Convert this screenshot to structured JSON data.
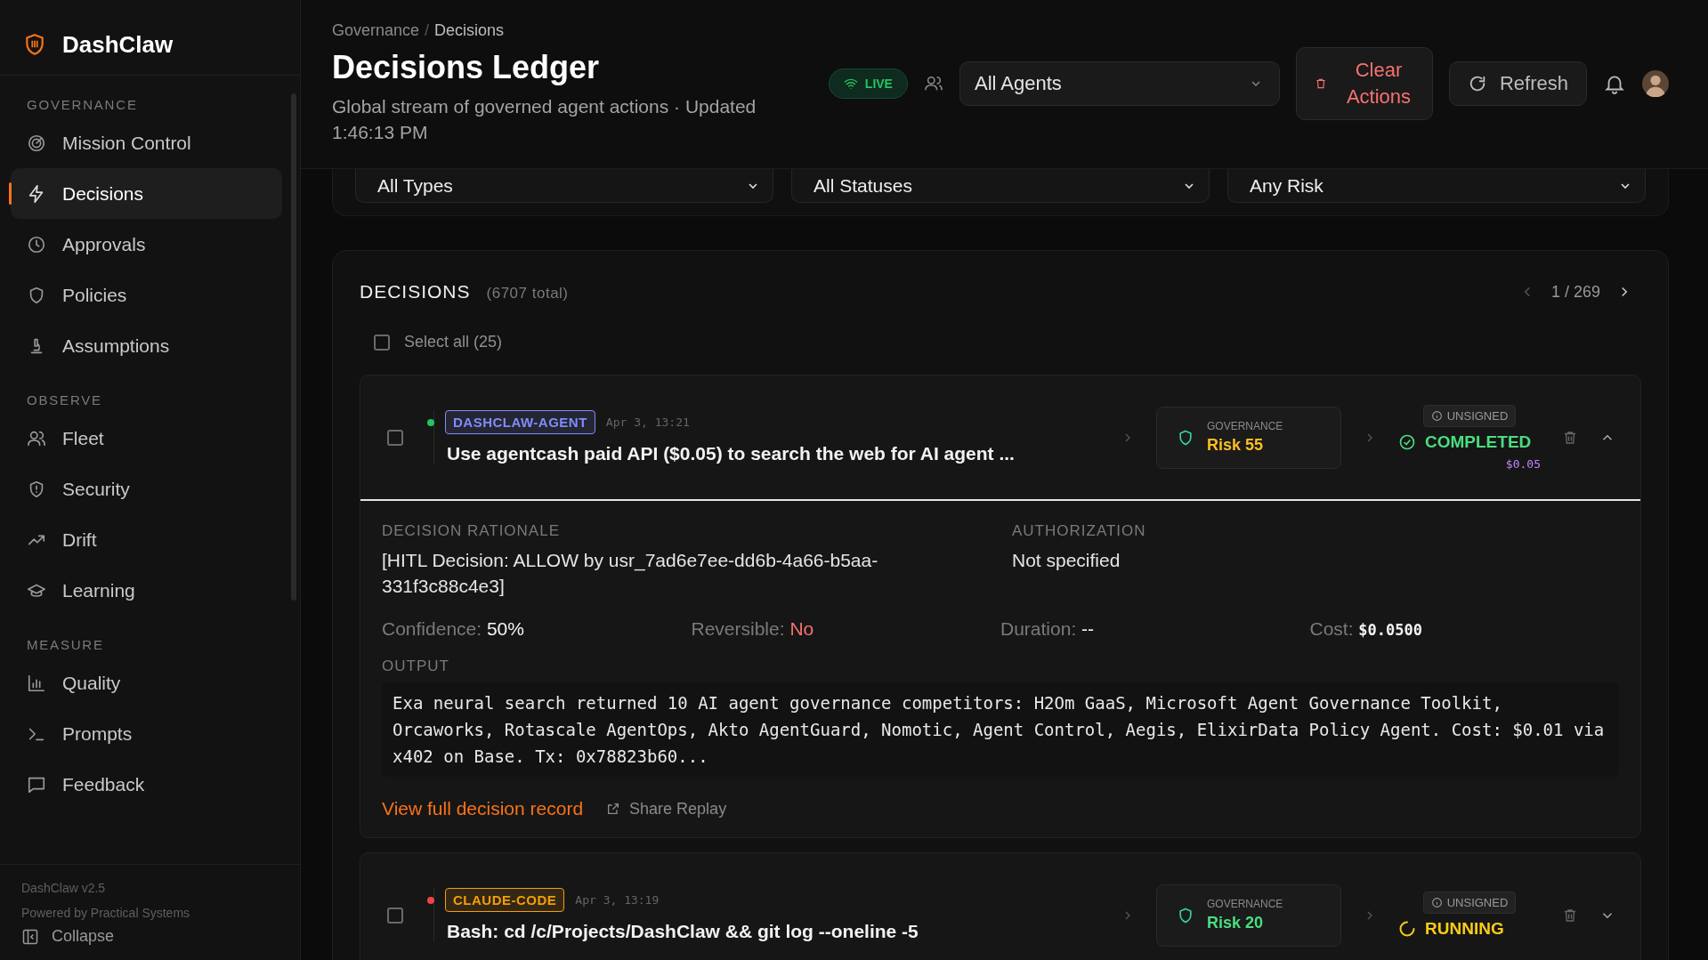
{
  "sidebar": {
    "brand": "DashClaw",
    "sections": [
      {
        "label": "GOVERNANCE",
        "items": [
          {
            "label": "Mission Control",
            "selected": false
          },
          {
            "label": "Decisions",
            "selected": true
          },
          {
            "label": "Approvals",
            "selected": false
          },
          {
            "label": "Policies",
            "selected": false
          },
          {
            "label": "Assumptions",
            "selected": false
          }
        ]
      },
      {
        "label": "OBSERVE",
        "items": [
          {
            "label": "Fleet",
            "selected": false
          },
          {
            "label": "Security",
            "selected": false
          },
          {
            "label": "Drift",
            "selected": false
          },
          {
            "label": "Learning",
            "selected": false
          }
        ]
      },
      {
        "label": "MEASURE",
        "items": [
          {
            "label": "Quality",
            "selected": false
          },
          {
            "label": "Prompts",
            "selected": false
          },
          {
            "label": "Feedback",
            "selected": false
          }
        ]
      }
    ],
    "version": "DashClaw v2.5",
    "powered": "Powered by Practical Systems",
    "collapse": "Collapse"
  },
  "header": {
    "breadcrumb": [
      "Governance",
      "Decisions"
    ],
    "breadcrumb_separator": "/",
    "title": "Decisions Ledger",
    "subtitle": "Global stream of governed agent actions · Updated 1:46:13 PM",
    "live": "LIVE",
    "agent_select": "All Agents",
    "clear": "Clear Actions",
    "refresh": "Refresh"
  },
  "filters": [
    "All Types",
    "All Statuses",
    "Any Risk"
  ],
  "decisions": {
    "title": "DECISIONS",
    "total": "(6707 total)",
    "page": "1 / 269",
    "select_all": {
      "label": "Select all (25)",
      "checked": false
    },
    "rows": [
      {
        "dot": {
          "color": "#22c55e"
        },
        "agent": {
          "name": "DASHCLAW-AGENT",
          "color": "#818cf8"
        },
        "time": "Apr 3, 13:21",
        "title": "Use agentcash paid API ($0.05) to search the web for AI agent ...",
        "gov_label": "GOVERNANCE",
        "risk": {
          "text": "Risk 55",
          "color": "#fbbf24"
        },
        "signature": "UNSIGNED",
        "status": {
          "text": "COMPLETED",
          "kind": "completed"
        },
        "cost": "$0.05",
        "checked": false,
        "expanded": true,
        "details": {
          "rationale_label": "DECISION RATIONALE",
          "rationale": "[HITL Decision: ALLOW by usr_7ad6e7ee-dd6b-4a66-b5aa-331f3c88c4e3]",
          "auth_label": "AUTHORIZATION",
          "auth": "Not specified",
          "metrics": [
            {
              "label": "Confidence:",
              "value": "50%",
              "kind": "plain"
            },
            {
              "label": "Reversible:",
              "value": "No",
              "kind": "negative"
            },
            {
              "label": "Duration:",
              "value": "--",
              "kind": "plain"
            },
            {
              "label": "Cost:",
              "value": "$0.0500",
              "kind": "mono"
            }
          ],
          "output_label": "OUTPUT",
          "output": "Exa neural search returned 10 AI agent governance competitors: H2Om GaaS, Microsoft Agent Governance Toolkit, Orcaworks, Rotascale AgentOps, Akto AgentGuard, Nomotic, Agent Control, Aegis, ElixirData Policy Agent. Cost: $0.01 via x402 on Base. Tx: 0x78823b60...",
          "link": "View full decision record",
          "share": "Share Replay"
        }
      },
      {
        "dot": {
          "color": "#ef4444"
        },
        "agent": {
          "name": "CLAUDE-CODE",
          "color": "#f59e0b"
        },
        "time": "Apr 3, 13:19",
        "title": "Bash: cd /c/Projects/DashClaw && git log --oneline -5",
        "gov_label": "GOVERNANCE",
        "risk": {
          "text": "Risk 20",
          "color": "#4ade80"
        },
        "signature": "UNSIGNED",
        "status": {
          "text": "RUNNING",
          "kind": "running"
        },
        "checked": false,
        "expanded": false
      }
    ]
  }
}
